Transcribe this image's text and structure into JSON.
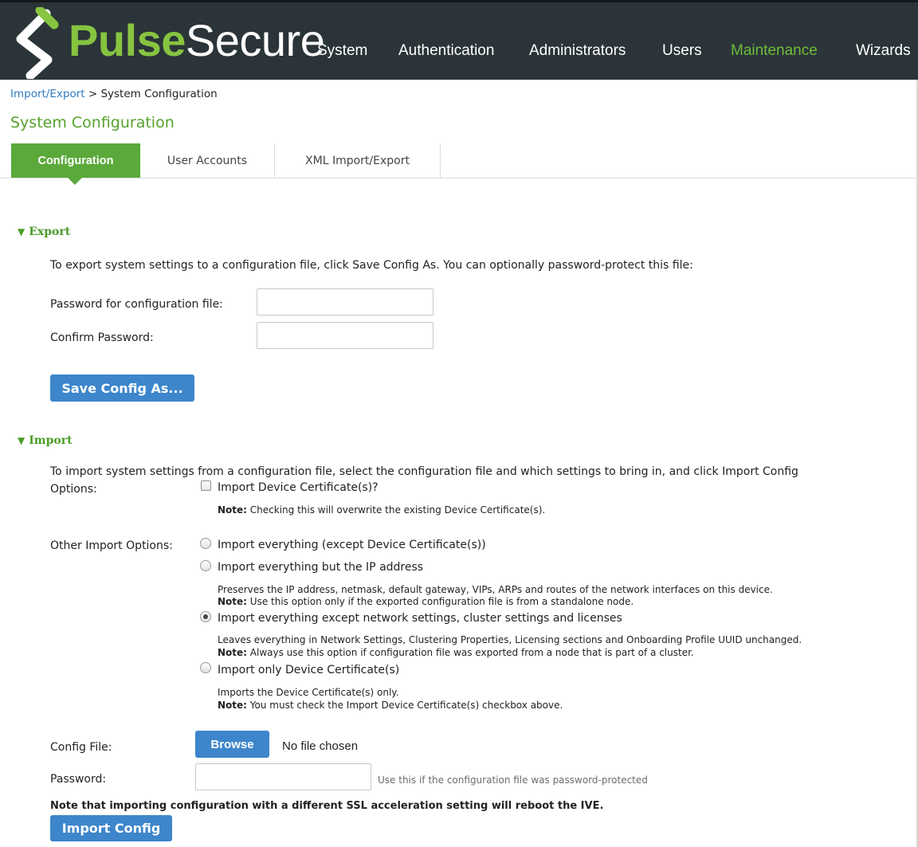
{
  "brand": {
    "name_part1": "Pulse",
    "name_part2": "Secure",
    "accent": "#87c440",
    "header_bg": "#2b3438"
  },
  "nav": [
    {
      "label": "System"
    },
    {
      "label": "Authentication"
    },
    {
      "label": "Administrators"
    },
    {
      "label": "Users"
    },
    {
      "label": "Maintenance",
      "active": true
    },
    {
      "label": "Wizards"
    }
  ],
  "breadcrumb": {
    "link": "Import/Export",
    "separator": ">",
    "current": "System Configuration"
  },
  "page_title": "System Configuration",
  "tabs": [
    {
      "label": "Configuration",
      "active": true
    },
    {
      "label": "User Accounts"
    },
    {
      "label": "XML Import/Export"
    }
  ],
  "export": {
    "heading": "Export",
    "description": "To export system settings to a configuration file, click Save Config As. You can optionally password-protect this file:",
    "password_label": "Password for configuration file:",
    "confirm_label": "Confirm Password:",
    "password_value": "",
    "confirm_value": "",
    "save_button": "Save Config As..."
  },
  "import": {
    "heading": "Import",
    "description": "To import system settings from a configuration file, select the configuration file and which settings to bring in, and click Import Config",
    "options_label": "Options:",
    "device_cert_checkbox": {
      "label": "Import Device Certificate(s)?",
      "checked": false
    },
    "device_cert_note_bold": "Note:",
    "device_cert_note": " Checking this will overwrite the existing Device Certificate(s).",
    "other_label": "Other Import Options:",
    "radio_options": [
      {
        "label": "Import everything (except Device Certificate(s))",
        "checked": false
      },
      {
        "label": "Import everything but the IP address",
        "checked": false,
        "desc": "Preserves the IP address, netmask, default gateway, VIPs, ARPs and routes of the network interfaces on this device.",
        "note_bold": "Note:",
        "note": " Use this option only if the exported configuration file is from a standalone node."
      },
      {
        "label": "Import everything except network settings, cluster settings and licenses",
        "checked": true,
        "desc": "Leaves everything in Network Settings, Clustering Properties, Licensing sections and Onboarding Profile UUID unchanged.",
        "note_bold": "Note:",
        "note": " Always use this option if configuration file was exported from a node that is part of a cluster."
      },
      {
        "label": "Import only Device Certificate(s)",
        "checked": false,
        "desc": "Imports the Device Certificate(s) only.",
        "note_bold": "Note:",
        "note": " You must check the Import Device Certificate(s) checkbox above."
      }
    ],
    "config_file_label": "Config File:",
    "browse_button": "Browse",
    "no_file": "No file chosen",
    "password_label": "Password:",
    "password_value": "",
    "password_hint": "Use this if the configuration file was password-protected",
    "ssl_warning": "Note that importing configuration with a different SSL acceleration setting will reboot the IVE.",
    "import_button": "Import Config"
  }
}
